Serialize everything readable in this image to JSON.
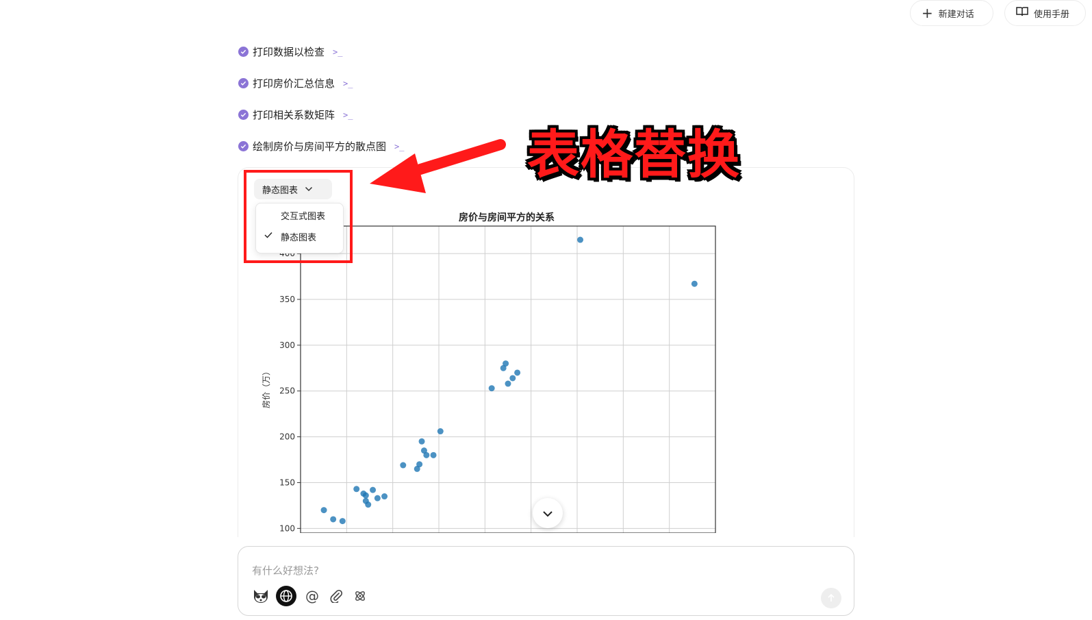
{
  "header": {
    "new_chat_label": "新建对话",
    "manual_label": "使用手册"
  },
  "steps": [
    {
      "label": "打印数据以检查"
    },
    {
      "label": "打印房价汇总信息"
    },
    {
      "label": "打印相关系数矩阵"
    },
    {
      "label": "绘制房价与房间平方的散点图"
    }
  ],
  "chart_select": {
    "current": "静态图表",
    "options": [
      "交互式图表",
      "静态图表"
    ],
    "selected_index": 1
  },
  "annotation": {
    "title": "表格替换",
    "color": "#ff1a1a"
  },
  "colors": {
    "accent": "#8b74d6",
    "marker": "#1f77b4"
  },
  "chart_data": {
    "type": "scatter",
    "title": "房价与房间平方的关系",
    "xlabel": "",
    "ylabel": "房价（万）",
    "ylim_visible": [
      100,
      430
    ],
    "y_ticks": [
      100,
      150,
      200,
      250,
      300,
      350,
      400
    ],
    "grid": true,
    "points": [
      [
        0.5,
        120
      ],
      [
        0.7,
        110
      ],
      [
        0.9,
        108
      ],
      [
        1.2,
        143
      ],
      [
        1.35,
        138
      ],
      [
        1.4,
        130
      ],
      [
        1.45,
        126
      ],
      [
        1.55,
        142
      ],
      [
        1.65,
        133
      ],
      [
        1.8,
        135
      ],
      [
        1.4,
        136
      ],
      [
        2.2,
        169
      ],
      [
        2.5,
        165
      ],
      [
        2.55,
        170
      ],
      [
        2.6,
        195
      ],
      [
        2.65,
        185
      ],
      [
        2.7,
        180
      ],
      [
        2.85,
        180
      ],
      [
        3.0,
        206
      ],
      [
        4.1,
        253
      ],
      [
        4.35,
        275
      ],
      [
        4.4,
        280
      ],
      [
        4.45,
        258
      ],
      [
        4.55,
        264
      ],
      [
        4.65,
        270
      ],
      [
        6.0,
        415
      ],
      [
        8.45,
        367
      ]
    ],
    "x_visible": [
      0,
      8.9
    ]
  },
  "input": {
    "placeholder": "有什么好想法?"
  }
}
